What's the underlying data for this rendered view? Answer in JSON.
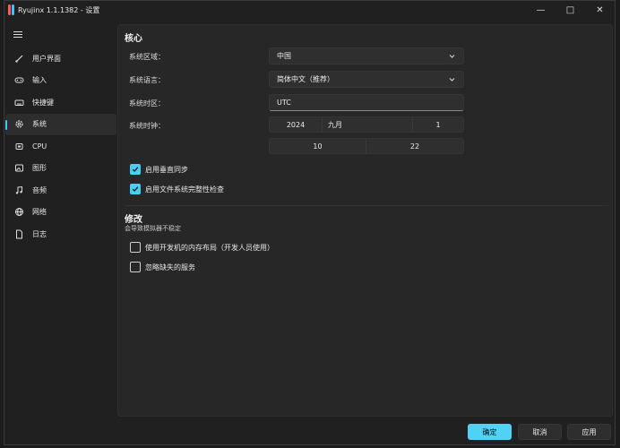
{
  "window": {
    "title": "Ryujinx 1.1.1382 - 设置",
    "controls": [
      "—",
      "□",
      "✕"
    ]
  },
  "sidebar": {
    "items": [
      {
        "label": "用户界面",
        "icon": "brush-icon"
      },
      {
        "label": "输入",
        "icon": "gamepad-icon"
      },
      {
        "label": "快捷键",
        "icon": "keyboard-icon"
      },
      {
        "label": "系统",
        "icon": "gear-icon",
        "active": true
      },
      {
        "label": "CPU",
        "icon": "cpu-icon"
      },
      {
        "label": "图形",
        "icon": "image-icon"
      },
      {
        "label": "音频",
        "icon": "music-icon"
      },
      {
        "label": "网络",
        "icon": "globe-icon"
      },
      {
        "label": "日志",
        "icon": "document-icon"
      }
    ]
  },
  "core": {
    "title": "核心",
    "region_label": "系统区域：",
    "region_value": "中国",
    "language_label": "系统语言：",
    "language_value": "简体中文（推荐）",
    "timezone_label": "系统时区：",
    "timezone_value": "UTC",
    "clock_label": "系统时钟：",
    "clock": {
      "year": "2024",
      "month": "九月",
      "day": "1",
      "hour": "10",
      "minute": "22"
    },
    "vsync_label": "启用垂直同步",
    "vsync_checked": true,
    "fs_check_label": "启用文件系统完整性检查",
    "fs_check_checked": true
  },
  "hacks": {
    "title": "修改",
    "subtitle": "会导致模拟器不稳定",
    "memory_label": "使用开发机的内存布局（开发人员使用）",
    "memory_checked": false,
    "ignore_label": "忽略缺失的服务",
    "ignore_checked": false
  },
  "footer": {
    "ok": "确定",
    "cancel": "取消",
    "apply": "应用"
  },
  "colors": {
    "accent": "#47d0f2",
    "background": "#202020",
    "panel": "#272727"
  }
}
